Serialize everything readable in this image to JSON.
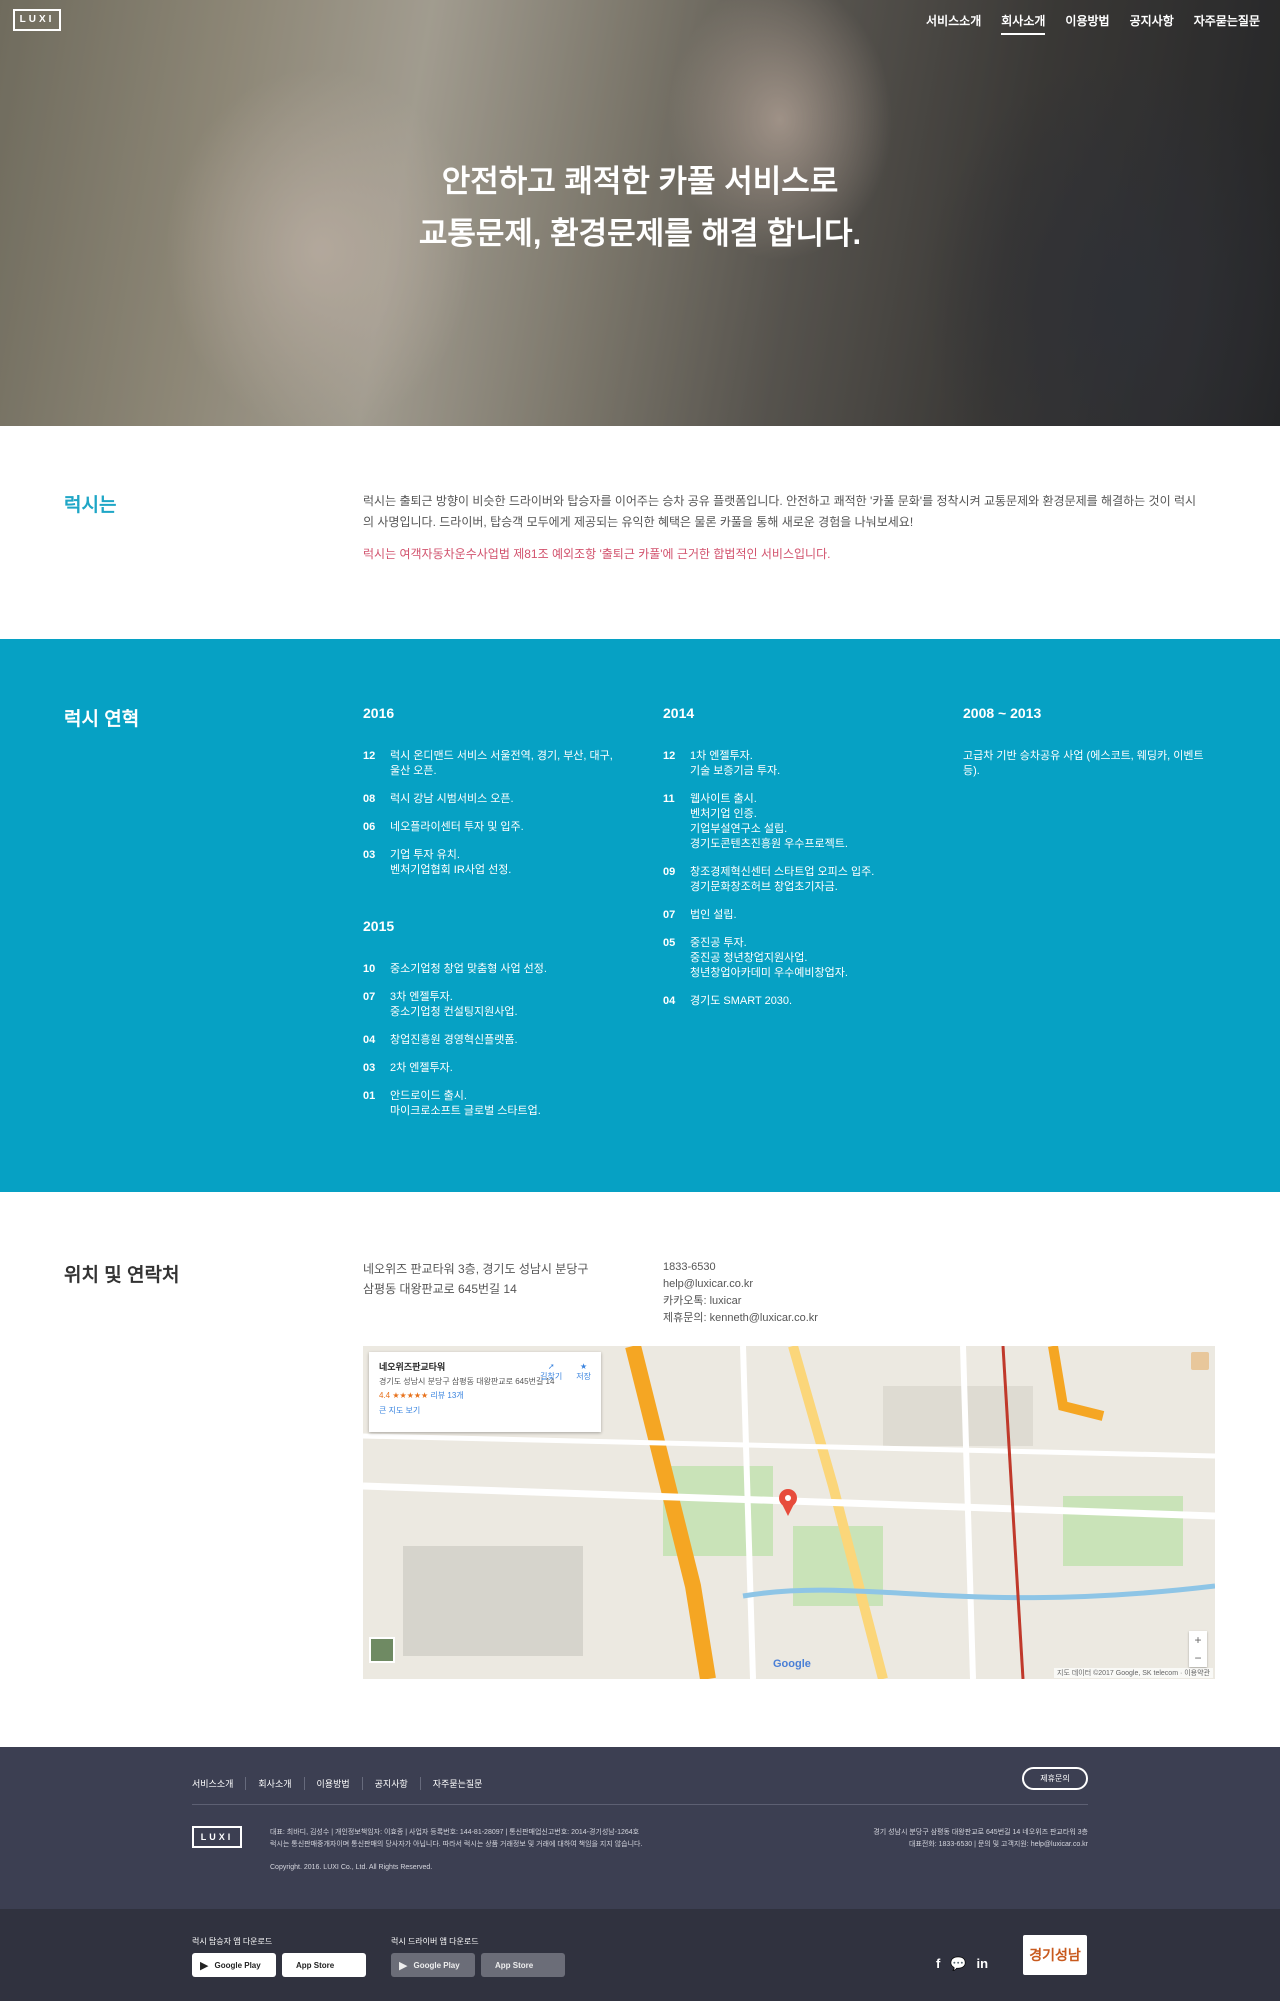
{
  "header": {
    "logo": "LUXI",
    "nav": [
      "서비스소개",
      "회사소개",
      "이용방법",
      "공지사항",
      "자주묻는질문"
    ],
    "active_nav": "회사소개"
  },
  "hero": {
    "line1": "안전하고 쾌적한 카풀 서비스로",
    "line2": "교통문제, 환경문제를 해결 합니다."
  },
  "about": {
    "heading": "럭시는",
    "text": "럭시는 출퇴근 방향이 비슷한 드라이버와 탑승자를 이어주는 승차 공유 플랫폼입니다. 안전하고 쾌적한 '카풀 문화'를 정착시켜 교통문제와 환경문제를 해결하는 것이 럭시의 사명입니다. 드라이버, 탑승객 모두에게 제공되는 유익한 혜택은 물론 카풀을 통해 새로운 경험을 나눠보세요!",
    "legal": "럭시는 여객자동차운수사업법 제81조 예외조항 '출퇴근 카풀'에 근거한 합법적인 서비스입니다."
  },
  "history": {
    "heading": "럭시 연혁",
    "y2016": {
      "year": "2016",
      "events": [
        {
          "month": "12",
          "text": "럭시 온디맨드 서비스 서울전역, 경기, 부산, 대구,\n울산 오픈."
        },
        {
          "month": "08",
          "text": "럭시 강남 시범서비스 오픈."
        },
        {
          "month": "06",
          "text": "네오플라이센터 투자 및 입주."
        },
        {
          "month": "03",
          "text": "기업 투자 유치.\n벤처기업협회 IR사업 선정."
        }
      ]
    },
    "y2015": {
      "year": "2015",
      "events": [
        {
          "month": "10",
          "text": "중소기업청 창업 맞춤형 사업 선정."
        },
        {
          "month": "07",
          "text": "3차 엔젤투자.\n중소기업청 컨설팅지원사업."
        },
        {
          "month": "04",
          "text": "창업진흥원 경영혁신플랫폼."
        },
        {
          "month": "03",
          "text": "2차 엔젤투자."
        },
        {
          "month": "01",
          "text": "안드로이드 출시.\n마이크로소프트 글로벌 스타트업."
        }
      ]
    },
    "y2014": {
      "year": "2014",
      "events": [
        {
          "month": "12",
          "text": "1차 엔젤투자.\n기술 보증기금 투자."
        },
        {
          "month": "11",
          "text": "웹사이트 출시.\n벤처기업 인증.\n기업부설연구소 설립.\n경기도콘텐츠진흥원 우수프로젝트."
        },
        {
          "month": "09",
          "text": "창조경제혁신센터 스타트업 오피스 입주.\n경기문화창조허브 창업초기자금."
        },
        {
          "month": "07",
          "text": "법인 설립."
        },
        {
          "month": "05",
          "text": "중진공 투자.\n중진공 청년창업지원사업.\n청년창업아카데미 우수예비창업자."
        },
        {
          "month": "04",
          "text": "경기도 SMART 2030."
        }
      ]
    },
    "y2008": {
      "year": "2008 ~ 2013",
      "text": "고급차 기반 승차공유 사업 (에스코트, 웨딩카, 이벤트 등)."
    }
  },
  "location": {
    "heading": "위치 및 연락처",
    "address": "네오위즈 판교타워 3층, 경기도 성남시 분당구\n삼평동 대왕판교로 645번길 14",
    "phone": "1833-6530",
    "email": "help@luxicar.co.kr",
    "kakao": "카카오톡: luxicar",
    "partner": "제휴문의: kenneth@luxicar.co.kr",
    "map": {
      "place": "네오위즈판교타워",
      "place_address": "경기도 성남시 분당구 삼평동 대왕판교로 645번길 14",
      "rating": "4.4 ★★★★★",
      "reviews": "리뷰 13개",
      "bigger_map": "큰 지도 보기",
      "directions": "길찾기",
      "save": "저장",
      "brand": "Google",
      "attribution": "지도 데이터 ©2017 Google, SK telecom · 이용약관",
      "zoom_in": "+",
      "zoom_out": "−"
    }
  },
  "footer": {
    "nav": [
      "서비스소개",
      "회사소개",
      "이용방법",
      "공지사항",
      "자주묻는질문"
    ],
    "partner_button": "제휴문의",
    "logo": "LUXI",
    "info1": "대표: 최바디, 김성수 | 개인정보책임자: 이효종 | 사업자 등록번호: 144-81-28097 | 통신판매업신고번호: 2014-경기성남-1264호",
    "info2": "럭시는 통신판매중개자이며 통신판매의 당사자가 아닙니다. 따라서 럭시는 상품 거래정보 및 거래에 대하여 책임을 지지 않습니다.",
    "copyright": "Copyright. 2016. LUXI Co., Ltd. All Rights Reserved.",
    "right1": "경기 성남시 분당구 삼평동 대왕판교로 645번길 14 네오위즈 판교타워 3층",
    "right2": "대표전화: 1833-6530 | 문의 및 고객지원: help@luxicar.co.kr"
  },
  "downloads": {
    "rider_label": "럭시 탑승자 앱 다운로드",
    "driver_label": "럭시 드라이버 앱 다운로드",
    "google_play": "Google Play",
    "app_store": "App Store",
    "badge": "경기성남"
  }
}
